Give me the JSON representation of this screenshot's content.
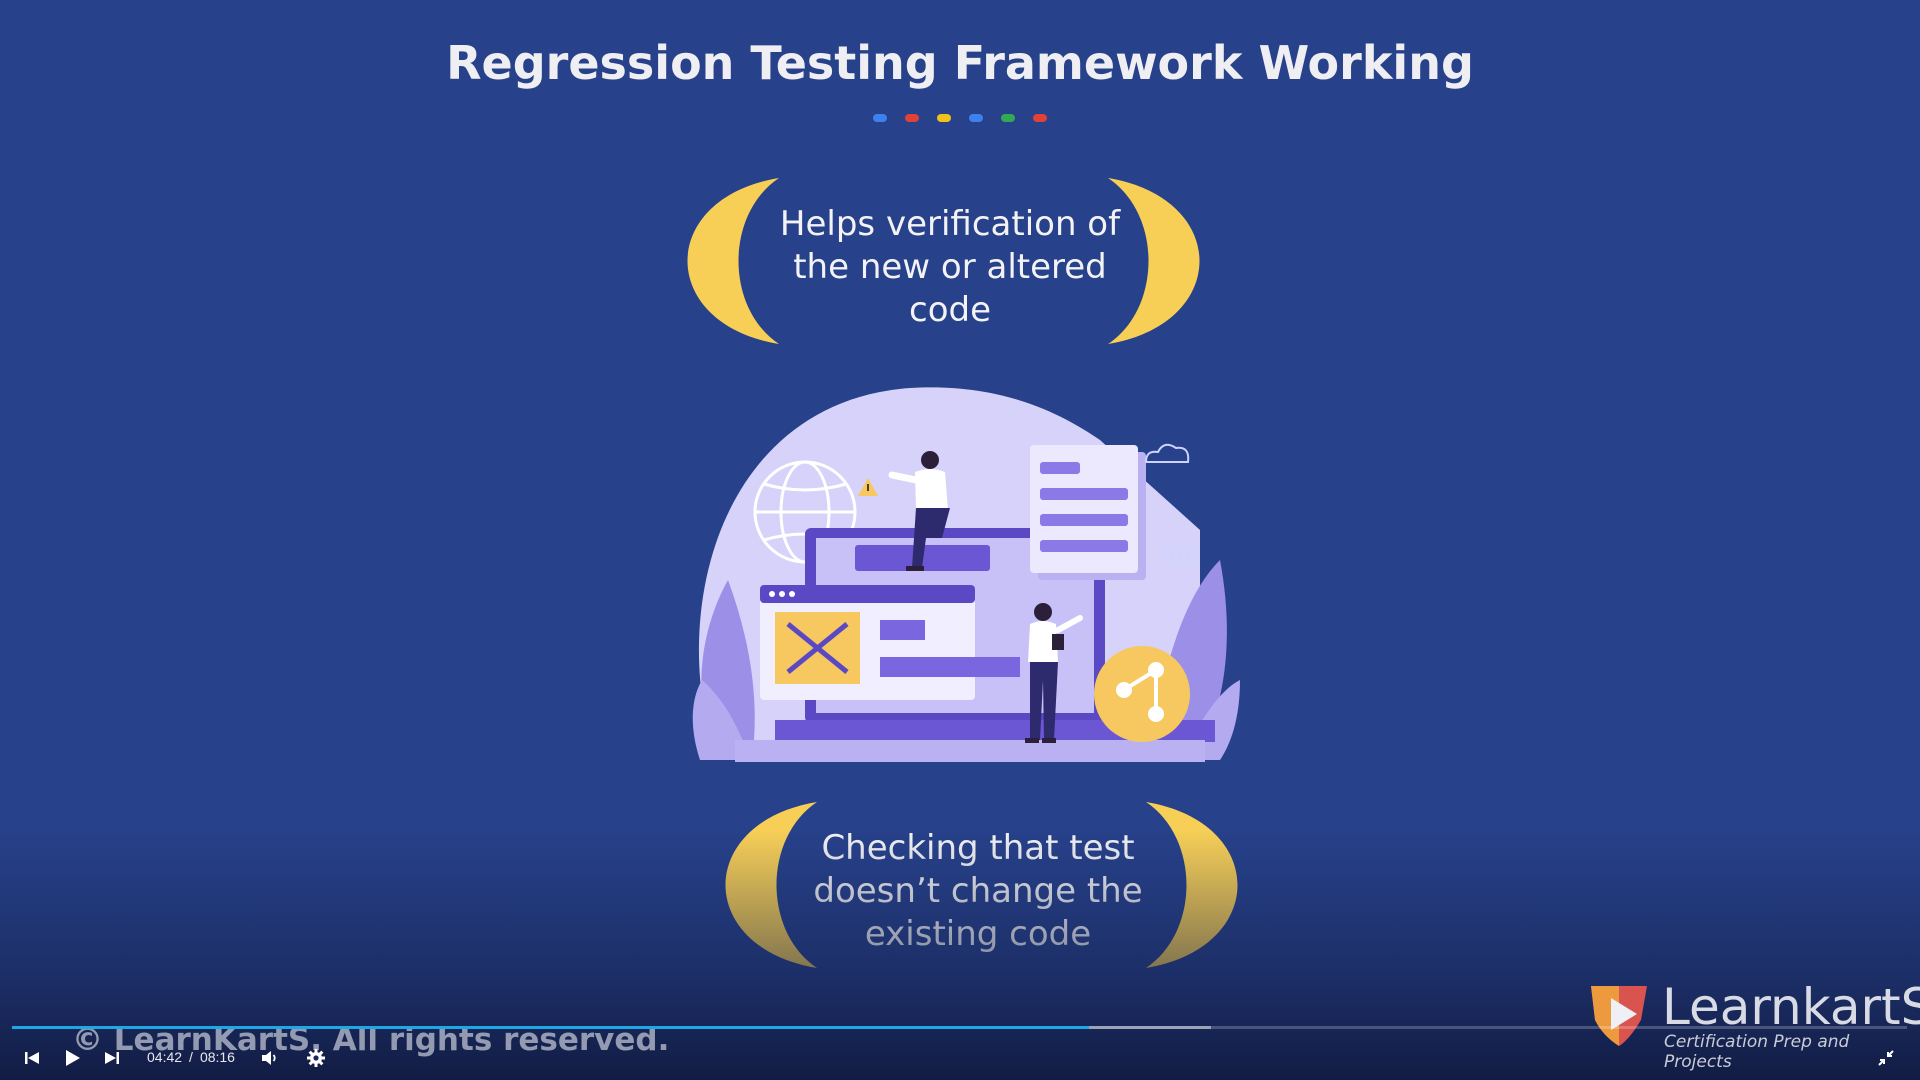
{
  "slide": {
    "title": "Regression Testing Framework Working",
    "dot_colors": [
      "#3b82f0",
      "#e0413b",
      "#f2c21c",
      "#3b82f0",
      "#34a853",
      "#e0413b"
    ],
    "points": [
      {
        "lines": [
          "Helps verification of",
          "the new or altered",
          "code"
        ]
      },
      {
        "lines": [
          "Checking that test",
          "doesn’t change the",
          "existing code"
        ]
      }
    ],
    "bracket_color": "#f7cf57",
    "copyright": "© LearnKartS. All rights reserved.",
    "logo": {
      "name": "LearnkartS",
      "tagline": "Certification Prep and Projects"
    }
  },
  "player": {
    "current_time": "04:42",
    "separator": "/",
    "duration": "08:16",
    "progress_fraction": 0.5685,
    "buffered_fraction": 0.6325,
    "accent_color": "#1ea6e6",
    "icons": {
      "previous": "skip-previous-icon",
      "play": "play-icon",
      "next": "skip-next-icon",
      "volume": "volume-icon",
      "settings": "gear-icon",
      "fullscreen": "fullscreen-exit-icon"
    }
  }
}
